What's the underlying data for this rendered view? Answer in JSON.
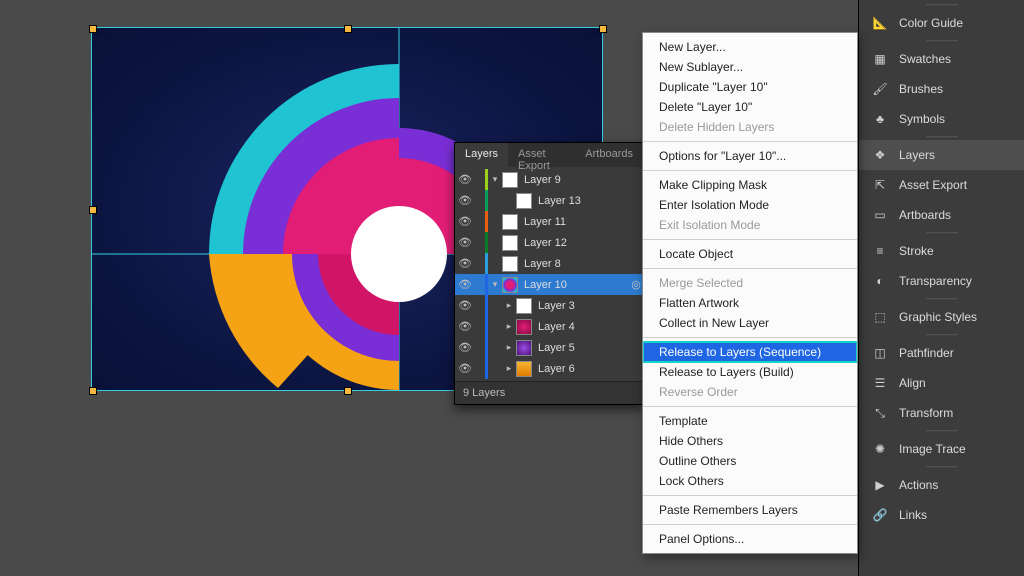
{
  "badges": [
    {
      "group": 0,
      "name": "Color Guide",
      "icon": "color-guide"
    },
    {
      "group": 1,
      "name": "Swatches",
      "icon": "swatches"
    },
    {
      "group": 1,
      "name": "Brushes",
      "icon": "brushes"
    },
    {
      "group": 1,
      "name": "Symbols",
      "icon": "symbols"
    },
    {
      "group": 2,
      "name": "Layers",
      "icon": "layers",
      "active": true
    },
    {
      "group": 2,
      "name": "Asset Export",
      "icon": "asset-export"
    },
    {
      "group": 2,
      "name": "Artboards",
      "icon": "artboards"
    },
    {
      "group": 3,
      "name": "Stroke",
      "icon": "stroke"
    },
    {
      "group": 3,
      "name": "Transparency",
      "icon": "transparency"
    },
    {
      "group": 4,
      "name": "Graphic Styles",
      "icon": "graphic-styles"
    },
    {
      "group": 5,
      "name": "Pathfinder",
      "icon": "pathfinder"
    },
    {
      "group": 5,
      "name": "Align",
      "icon": "align"
    },
    {
      "group": 5,
      "name": "Transform",
      "icon": "transform"
    },
    {
      "group": 6,
      "name": "Image Trace",
      "icon": "image-trace"
    },
    {
      "group": 7,
      "name": "Actions",
      "icon": "actions"
    },
    {
      "group": 7,
      "name": "Links",
      "icon": "links"
    }
  ],
  "panel": {
    "tabs": [
      "Layers",
      "Asset Export",
      "Artboards"
    ],
    "active_tab": 0,
    "footer": "9 Layers",
    "rows": [
      {
        "name": "Layer 9",
        "indent": 0,
        "color": "#9bd11a",
        "thumb": "white",
        "disclose": "down"
      },
      {
        "name": "Layer 13",
        "indent": 1,
        "color": "#0aa05c",
        "thumb": "white",
        "disclose": ""
      },
      {
        "name": "Layer 11",
        "indent": 0,
        "color": "#e85f14",
        "thumb": "white",
        "disclose": ""
      },
      {
        "name": "Layer 12",
        "indent": 0,
        "color": "#0a7a2a",
        "thumb": "white",
        "disclose": ""
      },
      {
        "name": "Layer 8",
        "indent": 0,
        "color": "#2b9dd9",
        "thumb": "white",
        "disclose": ""
      },
      {
        "name": "Layer 10",
        "indent": 0,
        "color": "#1f66e5",
        "thumb": "logo",
        "disclose": "down",
        "selected": true,
        "target": true
      },
      {
        "name": "Layer 3",
        "indent": 1,
        "color": "#1f66e5",
        "thumb": "white",
        "disclose": "right"
      },
      {
        "name": "Layer 4",
        "indent": 1,
        "color": "#1f66e5",
        "thumb": "magenta",
        "disclose": "right"
      },
      {
        "name": "Layer 5",
        "indent": 1,
        "color": "#1f66e5",
        "thumb": "purple",
        "disclose": "right"
      },
      {
        "name": "Layer 6",
        "indent": 1,
        "color": "#1f66e5",
        "thumb": "orange",
        "disclose": "right"
      }
    ]
  },
  "context_menu": [
    {
      "label": "New Layer..."
    },
    {
      "label": "New Sublayer..."
    },
    {
      "label": "Duplicate \"Layer 10\""
    },
    {
      "label": "Delete \"Layer 10\""
    },
    {
      "label": "Delete Hidden Layers",
      "disabled": true
    },
    {
      "sep": true
    },
    {
      "label": "Options for \"Layer 10\"..."
    },
    {
      "sep": true
    },
    {
      "label": "Make Clipping Mask"
    },
    {
      "label": "Enter Isolation Mode"
    },
    {
      "label": "Exit Isolation Mode",
      "disabled": true
    },
    {
      "sep": true
    },
    {
      "label": "Locate Object"
    },
    {
      "sep": true
    },
    {
      "label": "Merge Selected",
      "disabled": true
    },
    {
      "label": "Flatten Artwork"
    },
    {
      "label": "Collect in New Layer"
    },
    {
      "sep": true
    },
    {
      "label": "Release to Layers (Sequence)",
      "selected": true
    },
    {
      "label": "Release to Layers (Build)"
    },
    {
      "label": "Reverse Order",
      "disabled": true
    },
    {
      "sep": true
    },
    {
      "label": "Template"
    },
    {
      "label": "Hide Others"
    },
    {
      "label": "Outline Others"
    },
    {
      "label": "Lock Others"
    },
    {
      "sep": true
    },
    {
      "label": "Paste Remembers Layers"
    },
    {
      "sep": true
    },
    {
      "label": "Panel Options..."
    }
  ],
  "icons": {
    "color-guide": "📐",
    "swatches": "▦",
    "brushes": "🖌",
    "symbols": "♣",
    "layers": "❖",
    "asset-export": "⇱",
    "artboards": "▭",
    "stroke": "≡",
    "transparency": "◐",
    "graphic-styles": "⬚",
    "pathfinder": "◫",
    "align": "☰",
    "transform": "⤡",
    "image-trace": "✺",
    "actions": "▶",
    "links": "🔗"
  }
}
